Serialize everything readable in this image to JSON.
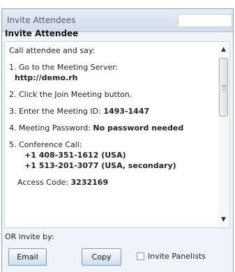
{
  "window": {
    "title": "Invite Attendees"
  },
  "heading": "Invite Attendee",
  "instructions": {
    "intro": "Call attendee and say:",
    "step1_label": "1. Go to the Meeting Server:",
    "step1_url": "http://demo.rh",
    "step2": "2. Click the Join Meeting button.",
    "step3_label": "3. Enter the Meeting ID: ",
    "step3_value": "1493-1447",
    "step4_label": "4. Meeting Password: ",
    "step4_value": "No password needed",
    "step5_label": "5. Conference Call:",
    "phone1": "+1 408-351-1612 (USA)",
    "phone2": "+1 513-201-3077 (USA, secondary)",
    "access_label": "Access Code: ",
    "access_value": "3232169"
  },
  "invite_by": {
    "label": "OR invite by:",
    "email_button": "Email",
    "copy_button": "Copy",
    "panelists_checkbox_label": "Invite Panelists",
    "panelists_checked": false
  }
}
